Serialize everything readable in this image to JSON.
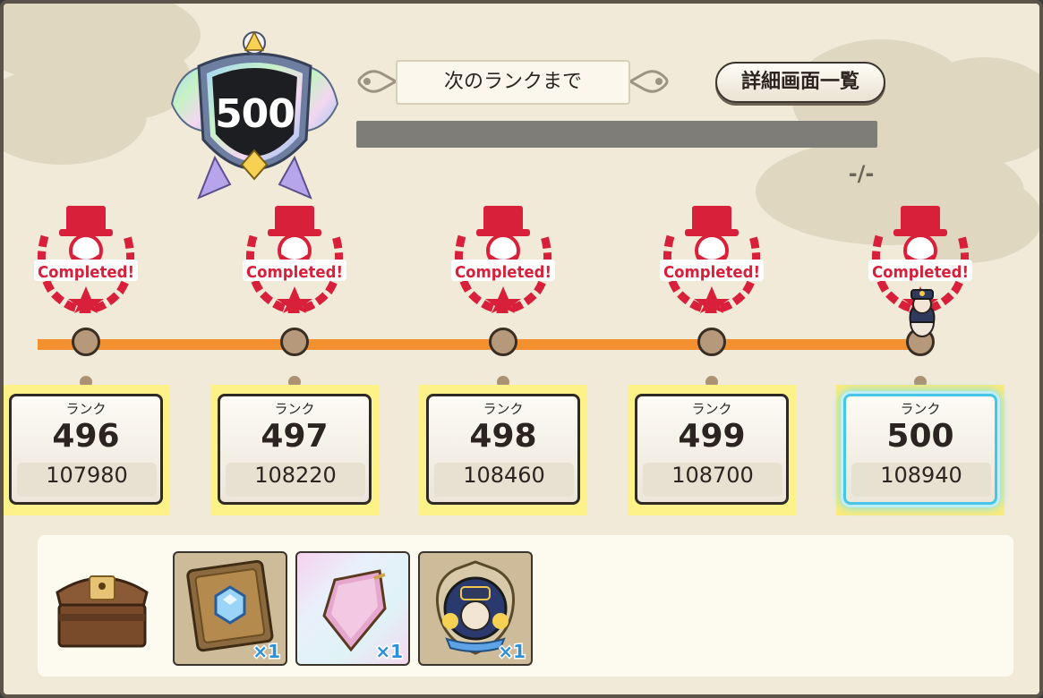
{
  "header": {
    "current_rank": "500",
    "next_rank_label": "次のランクまで",
    "detail_button": "詳細画面一覧",
    "progress_text": "-/-",
    "progress_fraction": 0
  },
  "timeline": {
    "stamp_text": "Completed!",
    "ranks": [
      {
        "label": "ランク",
        "rank": "496",
        "exp": "107980",
        "completed": true
      },
      {
        "label": "ランク",
        "rank": "497",
        "exp": "108220",
        "completed": true
      },
      {
        "label": "ランク",
        "rank": "498",
        "exp": "108460",
        "completed": true
      },
      {
        "label": "ランク",
        "rank": "499",
        "exp": "108700",
        "completed": true
      },
      {
        "label": "ランク",
        "rank": "500",
        "exp": "108940",
        "completed": true,
        "current": true
      }
    ]
  },
  "rewards": {
    "icon": "treasure-chest-icon",
    "items": [
      {
        "icon": "blue-gem-tablet-icon",
        "qty": "×1"
      },
      {
        "icon": "pink-crystal-icon",
        "qty": "×1"
      },
      {
        "icon": "character-badge-icon",
        "qty": "×1"
      }
    ]
  },
  "colors": {
    "stamp_red": "#d9203a",
    "timeline_orange": "#f3902f",
    "highlight_yellow": "#fcf289",
    "current_glow": "#48c5e8"
  }
}
